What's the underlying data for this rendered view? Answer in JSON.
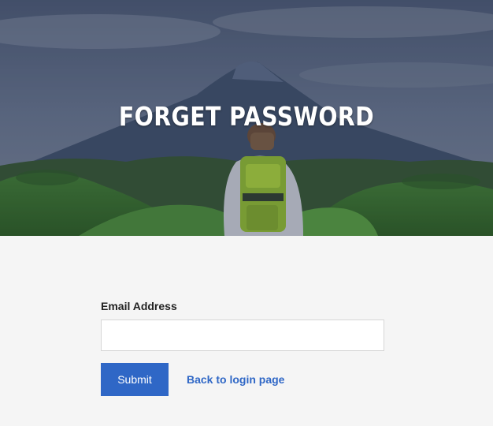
{
  "hero": {
    "title": "FORGET PASSWORD"
  },
  "form": {
    "email_label": "Email Address",
    "email_value": "",
    "email_placeholder": "",
    "submit_label": "Submit",
    "back_link_label": "Back to login page"
  }
}
